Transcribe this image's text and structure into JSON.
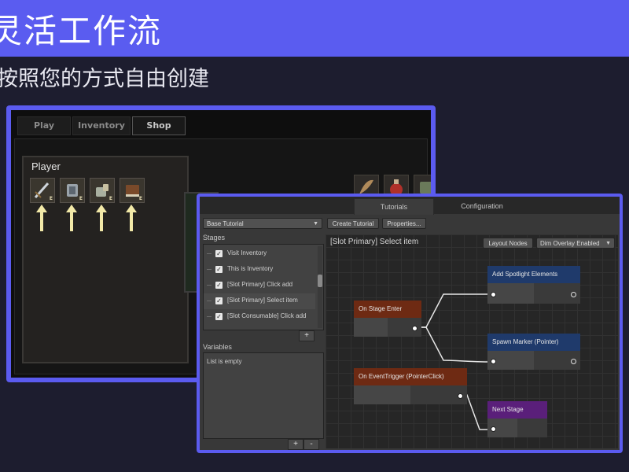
{
  "slide": {
    "title": "灵活工作流",
    "subtitle": "按照您的方式自由创建",
    "header_color": "#5a5cf0",
    "background_color": "#1d1d2f"
  },
  "game": {
    "tabs": [
      "Play",
      "Inventory",
      "Shop"
    ],
    "active_tab": "Shop",
    "player_title": "Player",
    "slots": [
      {
        "icon": "sword-icon",
        "badge": "E"
      },
      {
        "icon": "chest-armor-icon",
        "badge": "E"
      },
      {
        "icon": "gauntlet-icon",
        "badge": "E"
      },
      {
        "icon": "book-icon",
        "badge": "E"
      }
    ],
    "shop_items": [
      "feather-icon",
      "potion-icon",
      "armor-icon"
    ]
  },
  "editor": {
    "tabs": [
      "Tutorials",
      "Configuration"
    ],
    "active_tab": "Tutorials",
    "tutorial_dropdown": "Base Tutorial",
    "create_button": "Create Tutorial",
    "properties_button": "Properties...",
    "stages_label": "Stages",
    "stages": [
      {
        "label": "Visit Inventory",
        "checked": true
      },
      {
        "label": "This is Inventory",
        "checked": true
      },
      {
        "label": "[Slot Primary] Click add",
        "checked": true
      },
      {
        "label": "[Slot Primary] Select item",
        "checked": true,
        "selected": true
      },
      {
        "label": "[Slot Consumable] Click add",
        "checked": true
      }
    ],
    "add_stage": "+",
    "variables_label": "Variables",
    "variables_empty": "List is empty",
    "var_add": "+",
    "var_remove": "-",
    "graph_title": "[Slot Primary] Select item",
    "layout_nodes_button": "Layout Nodes",
    "overlay_dropdown": "Dim Overlay Enabled",
    "nodes": {
      "on_stage_enter": {
        "label": "On Stage Enter",
        "color": "#6e2a13"
      },
      "add_spotlight": {
        "label": "Add Spotlight Elements",
        "color": "#1f3a6b"
      },
      "spawn_marker": {
        "label": "Spawn Marker (Pointer)",
        "color": "#1f3a6b"
      },
      "on_event_trigger": {
        "label": "On EventTrigger (PointerClick)",
        "color": "#6e2a13"
      },
      "next_stage": {
        "label": "Next Stage",
        "color": "#5a1f7a"
      }
    }
  }
}
